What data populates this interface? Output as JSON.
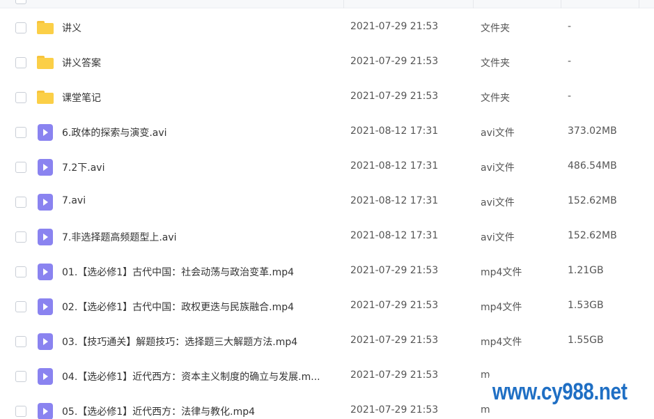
{
  "files": [
    {
      "name": "讲义",
      "time": "2021-07-29 21:53",
      "type": "文件夹",
      "size": "-",
      "icon": "folder-icon"
    },
    {
      "name": "讲义答案",
      "time": "2021-07-29 21:53",
      "type": "文件夹",
      "size": "-",
      "icon": "folder-icon"
    },
    {
      "name": "课堂笔记",
      "time": "2021-07-29 21:53",
      "type": "文件夹",
      "size": "-",
      "icon": "folder-icon"
    },
    {
      "name": "6.政体的探索与演变.avi",
      "time": "2021-08-12 17:31",
      "type": "avi文件",
      "size": "373.02MB",
      "icon": "video-file-icon"
    },
    {
      "name": "7.2下.avi",
      "time": "2021-08-12 17:31",
      "type": "avi文件",
      "size": "486.54MB",
      "icon": "video-file-icon"
    },
    {
      "name": "7.avi",
      "time": "2021-08-12 17:31",
      "type": "avi文件",
      "size": "152.62MB",
      "icon": "video-file-icon"
    },
    {
      "name": "7.非选择题高频题型上.avi",
      "time": "2021-08-12 17:31",
      "type": "avi文件",
      "size": "152.62MB",
      "icon": "video-file-icon"
    },
    {
      "name": "01.【选必修1】古代中国：社会动荡与政治变革.mp4",
      "time": "2021-07-29 21:53",
      "type": "mp4文件",
      "size": "1.21GB",
      "icon": "video-file-icon"
    },
    {
      "name": "02.【选必修1】古代中国：政权更迭与民族融合.mp4",
      "time": "2021-07-29 21:53",
      "type": "mp4文件",
      "size": "1.53GB",
      "icon": "video-file-icon"
    },
    {
      "name": "03.【技巧通关】解题技巧：选择题三大解题方法.mp4",
      "time": "2021-07-29 21:53",
      "type": "mp4文件",
      "size": "1.55GB",
      "icon": "video-file-icon"
    },
    {
      "name": "04.【选必修1】近代西方：资本主义制度的确立与发展.m...",
      "time": "2021-07-29 21:53",
      "type": "m",
      "size": "",
      "icon": "video-file-icon"
    },
    {
      "name": "05.【选必修1】近代西方：法律与教化.mp4",
      "time": "2021-07-29 21:53",
      "type": "m",
      "size": "",
      "icon": "video-file-icon"
    }
  ],
  "watermark": {
    "text": "www.cy988.net",
    "color": "#1f6fc4"
  },
  "colors": {
    "folder": "#fbcf47",
    "video": "#8a83f0"
  }
}
